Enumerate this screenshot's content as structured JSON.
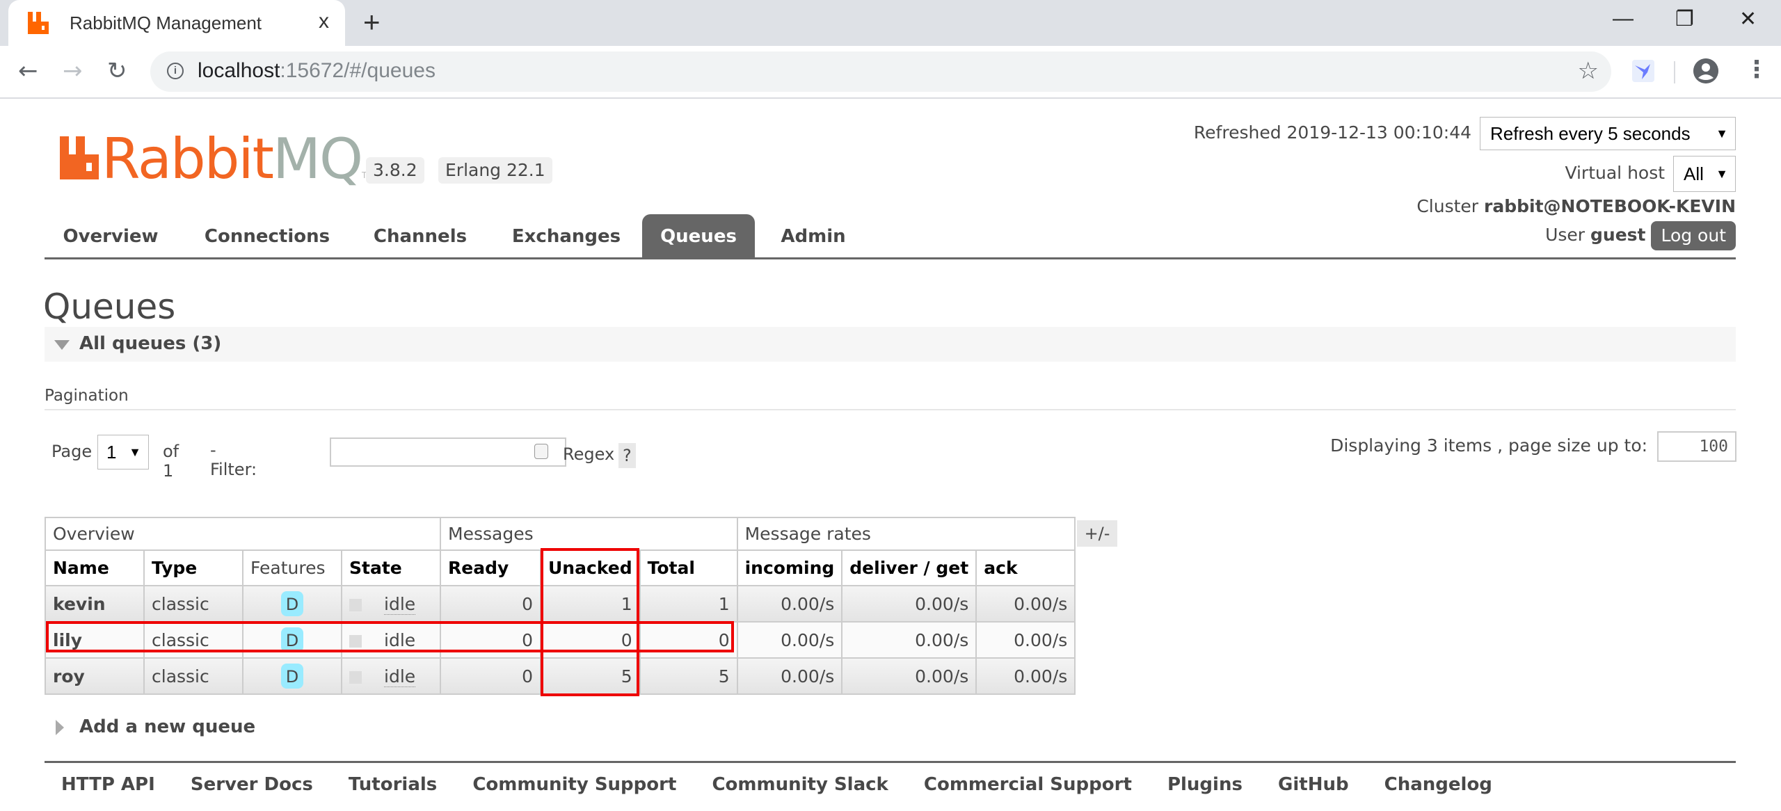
{
  "browser": {
    "tab_title": "RabbitMQ Management",
    "tab_close": "x",
    "new_tab": "+",
    "url_host": "localhost",
    "url_rest": ":15672/#/queues",
    "window_controls": {
      "minimize": "—",
      "restore": "❐",
      "close": "✕"
    }
  },
  "header": {
    "logo_rabbit": "Rabbit",
    "logo_mq": "MQ",
    "logo_tm": "TM",
    "version": "3.8.2",
    "erlang": "Erlang 22.1",
    "refreshed_label": "Refreshed 2019-12-13 00:10:44",
    "refresh_select": "Refresh every 5 seconds",
    "vhost_label": "Virtual host",
    "vhost_select": "All",
    "cluster_label": "Cluster",
    "cluster_name": "rabbit@NOTEBOOK-KEVIN",
    "user_label": "User",
    "user_name": "guest",
    "logout": "Log out"
  },
  "nav": {
    "items": [
      {
        "label": "Overview",
        "active": false
      },
      {
        "label": "Connections",
        "active": false
      },
      {
        "label": "Channels",
        "active": false
      },
      {
        "label": "Exchanges",
        "active": false
      },
      {
        "label": "Queues",
        "active": true
      },
      {
        "label": "Admin",
        "active": false
      }
    ]
  },
  "main": {
    "title": "Queues",
    "section_label": "All queues (3)",
    "pagination_label": "Pagination",
    "page_label": "Page",
    "page_value": "1",
    "of_label": "of 1",
    "filter_label": "- Filter:",
    "filter_value": "",
    "regex_label": "Regex",
    "help_label": "?",
    "displaying": "Displaying 3 items , page size up to:",
    "page_size": "100",
    "columns_toggle": "+/-",
    "add_queue": "Add a new queue"
  },
  "table": {
    "groups": [
      "Overview",
      "Messages",
      "Message rates"
    ],
    "columns": [
      "Name",
      "Type",
      "Features",
      "State",
      "Ready",
      "Unacked",
      "Total",
      "incoming",
      "deliver / get",
      "ack"
    ],
    "rows": [
      {
        "name": "kevin",
        "type": "classic",
        "features": "D",
        "state": "idle",
        "ready": "0",
        "unacked": "1",
        "total": "1",
        "incoming": "0.00/s",
        "deliver_get": "0.00/s",
        "ack": "0.00/s"
      },
      {
        "name": "lily",
        "type": "classic",
        "features": "D",
        "state": "idle",
        "ready": "0",
        "unacked": "0",
        "total": "0",
        "incoming": "0.00/s",
        "deliver_get": "0.00/s",
        "ack": "0.00/s"
      },
      {
        "name": "roy",
        "type": "classic",
        "features": "D",
        "state": "idle",
        "ready": "0",
        "unacked": "5",
        "total": "5",
        "incoming": "0.00/s",
        "deliver_get": "0.00/s",
        "ack": "0.00/s"
      }
    ]
  },
  "annotations": {
    "highlight_color": "#ee0000"
  },
  "footer": {
    "links": [
      "HTTP API",
      "Server Docs",
      "Tutorials",
      "Community Support",
      "Community Slack",
      "Commercial Support",
      "Plugins",
      "GitHub",
      "Changelog"
    ]
  },
  "colors": {
    "brand_orange": "#f26522",
    "brand_gray": "#a3b1aa",
    "nav_active": "#666666",
    "feature_badge": "#99ebff"
  }
}
